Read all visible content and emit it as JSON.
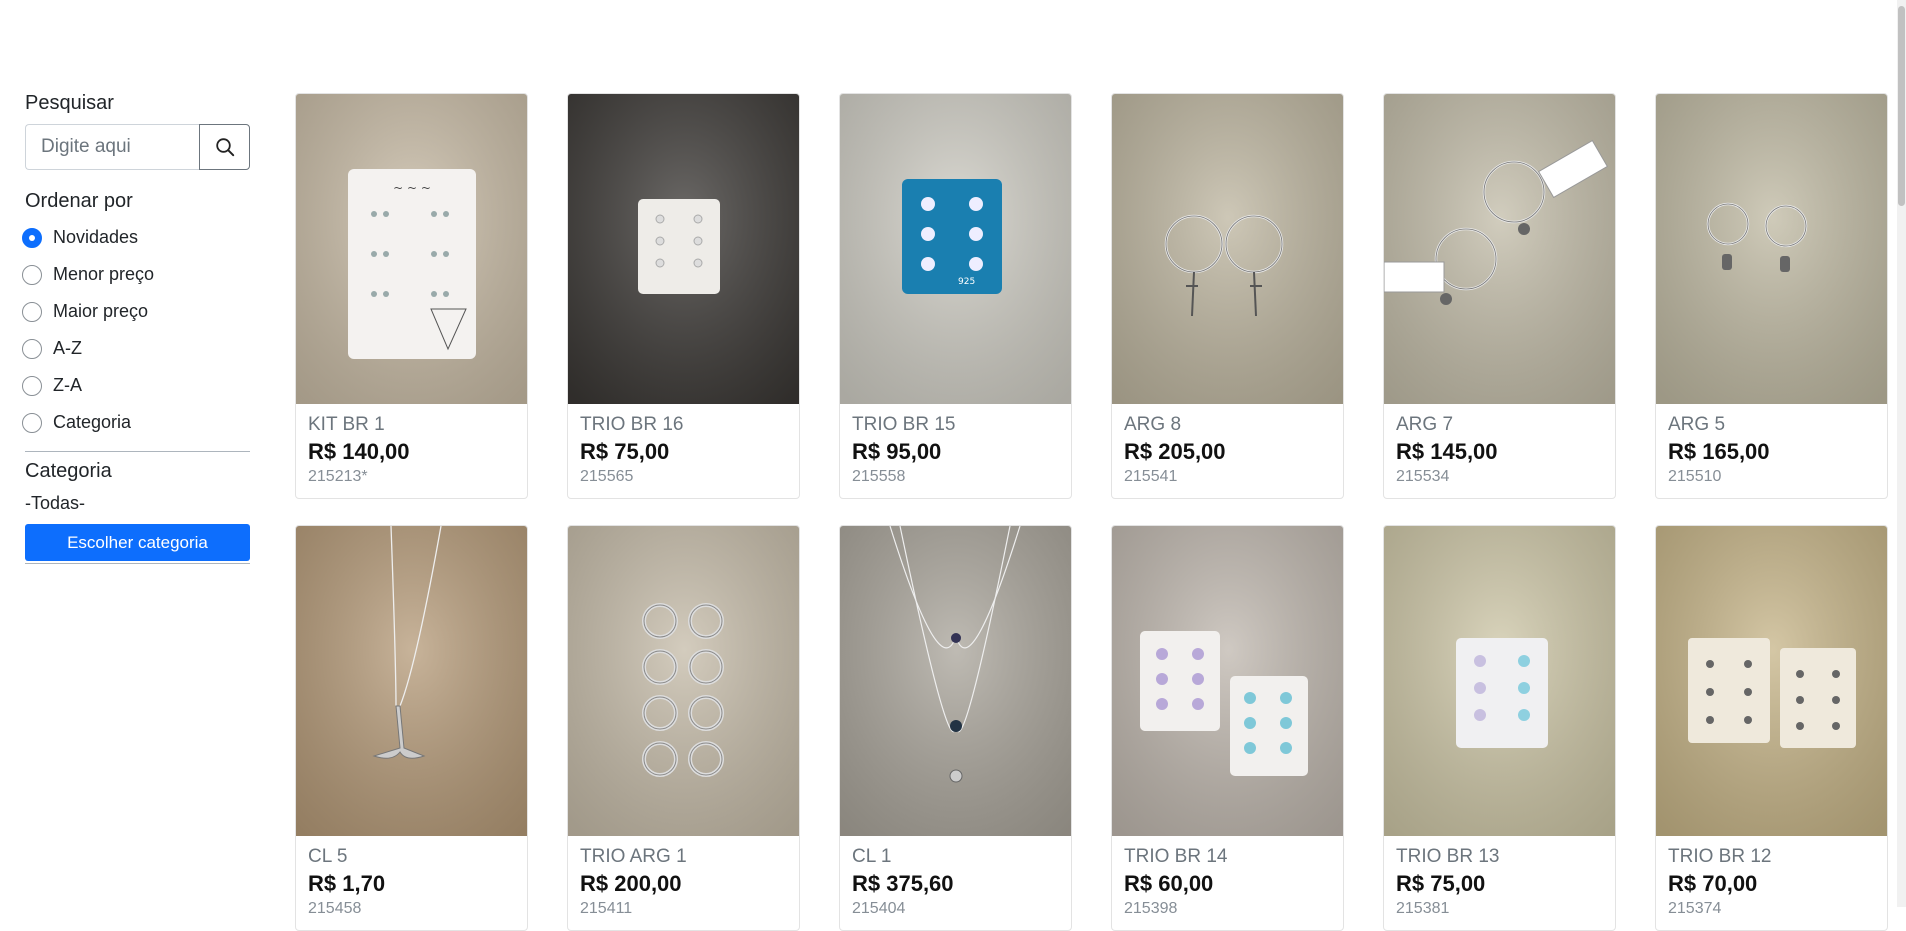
{
  "sidebar": {
    "search_label": "Pesquisar",
    "search_placeholder": "Digite aqui",
    "sort_label": "Ordenar por",
    "sort_options": [
      {
        "label": "Novidades",
        "checked": true
      },
      {
        "label": "Menor preço",
        "checked": false
      },
      {
        "label": "Maior preço",
        "checked": false
      },
      {
        "label": "A-Z",
        "checked": false
      },
      {
        "label": "Z-A",
        "checked": false
      },
      {
        "label": "Categoria",
        "checked": false
      }
    ],
    "category_label": "Categoria",
    "category_value": "-Todas-",
    "category_button": "Escolher categoria"
  },
  "products": [
    {
      "name": "KIT BR 1",
      "price": "R$ 140,00",
      "code": "215213*",
      "photo_bg": "#c8bba5",
      "item": "card-kit",
      "icon": "earring-card-icon"
    },
    {
      "name": "TRIO BR 16",
      "price": "R$ 75,00",
      "code": "215565",
      "photo_bg": "#3a3734",
      "item": "small-card",
      "icon": "stud-earrings-icon"
    },
    {
      "name": "TRIO BR 15",
      "price": "R$ 95,00",
      "code": "215558",
      "photo_bg": "#cfcdc4",
      "item": "blue-card",
      "icon": "stud-earrings-icon"
    },
    {
      "name": "ARG 8",
      "price": "R$ 205,00",
      "code": "215541",
      "photo_bg": "#bdb59f",
      "item": "hoops-cross",
      "icon": "hoop-earrings-icon"
    },
    {
      "name": "ARG 7",
      "price": "R$ 145,00",
      "code": "215534",
      "photo_bg": "#c2bca8",
      "item": "hoops-tag",
      "icon": "hoop-earrings-icon"
    },
    {
      "name": "ARG 5",
      "price": "R$ 165,00",
      "code": "215510",
      "photo_bg": "#bfb9a2",
      "item": "hoops-hamsa",
      "icon": "hoop-earrings-icon"
    },
    {
      "name": "CL 5",
      "price": "R$ 1,70",
      "code": "215458",
      "photo_bg": "#b59a78",
      "item": "necklace-tail",
      "icon": "necklace-icon"
    },
    {
      "name": "TRIO ARG 1",
      "price": "R$ 200,00",
      "code": "215411",
      "photo_bg": "#c5bba8",
      "item": "rings-grid",
      "icon": "hoop-earrings-icon"
    },
    {
      "name": "CL 1",
      "price": "R$ 375,60",
      "code": "215404",
      "photo_bg": "#a9a49a",
      "item": "necklace-layered",
      "icon": "necklace-icon"
    },
    {
      "name": "TRIO BR 14",
      "price": "R$ 60,00",
      "code": "215398",
      "photo_bg": "#bfb7ae",
      "item": "two-cards",
      "icon": "stud-earrings-icon"
    },
    {
      "name": "TRIO BR 13",
      "price": "R$ 75,00",
      "code": "215381",
      "photo_bg": "#cdc6a6",
      "item": "white-card",
      "icon": "stud-earrings-icon"
    },
    {
      "name": "TRIO BR 12",
      "price": "R$ 70,00",
      "code": "215374",
      "photo_bg": "#c6b487",
      "item": "two-cards-small",
      "icon": "stud-earrings-icon"
    }
  ]
}
